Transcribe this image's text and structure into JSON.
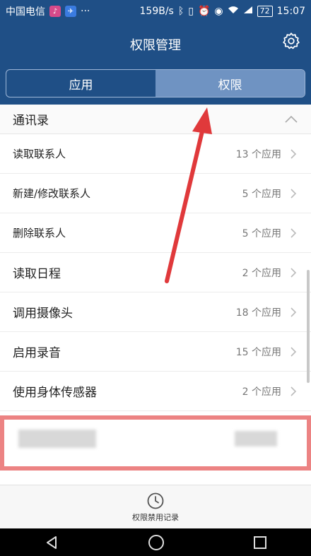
{
  "status_bar": {
    "carrier": "中国电信",
    "icons_left": [
      "music-app-icon",
      "bluetooth-app-icon"
    ],
    "more": "···",
    "speed": "159B/s",
    "icons_right": [
      "bluetooth-icon",
      "vibrate-icon",
      "alarm-icon",
      "eye-icon",
      "wifi-icon",
      "signal-4g-icon"
    ],
    "battery": "72",
    "time": "15:07"
  },
  "header": {
    "title": "权限管理",
    "settings_icon": "gear-icon"
  },
  "tabs": [
    {
      "label": "应用",
      "active": false
    },
    {
      "label": "权限",
      "active": true
    }
  ],
  "list": {
    "section_title": "通讯录",
    "rows": [
      {
        "label": "读取联系人",
        "count": "13 个应用"
      },
      {
        "label": "新建/修改联系人",
        "count": "5 个应用"
      },
      {
        "label": "删除联系人",
        "count": "5 个应用"
      },
      {
        "label": "读取日程",
        "count": "2 个应用"
      },
      {
        "label": "调用摄像头",
        "count": "18 个应用"
      },
      {
        "label": "启用录音",
        "count": "15 个应用"
      },
      {
        "label": "使用身体传感器",
        "count": "2 个应用"
      }
    ]
  },
  "bottom": {
    "history_label": "权限禁用记录",
    "history_icon": "clock-icon"
  },
  "colors": {
    "header_bg": "#1f4f86",
    "tab_active": "#6f93c2",
    "annotation_red": "#e0393b"
  }
}
